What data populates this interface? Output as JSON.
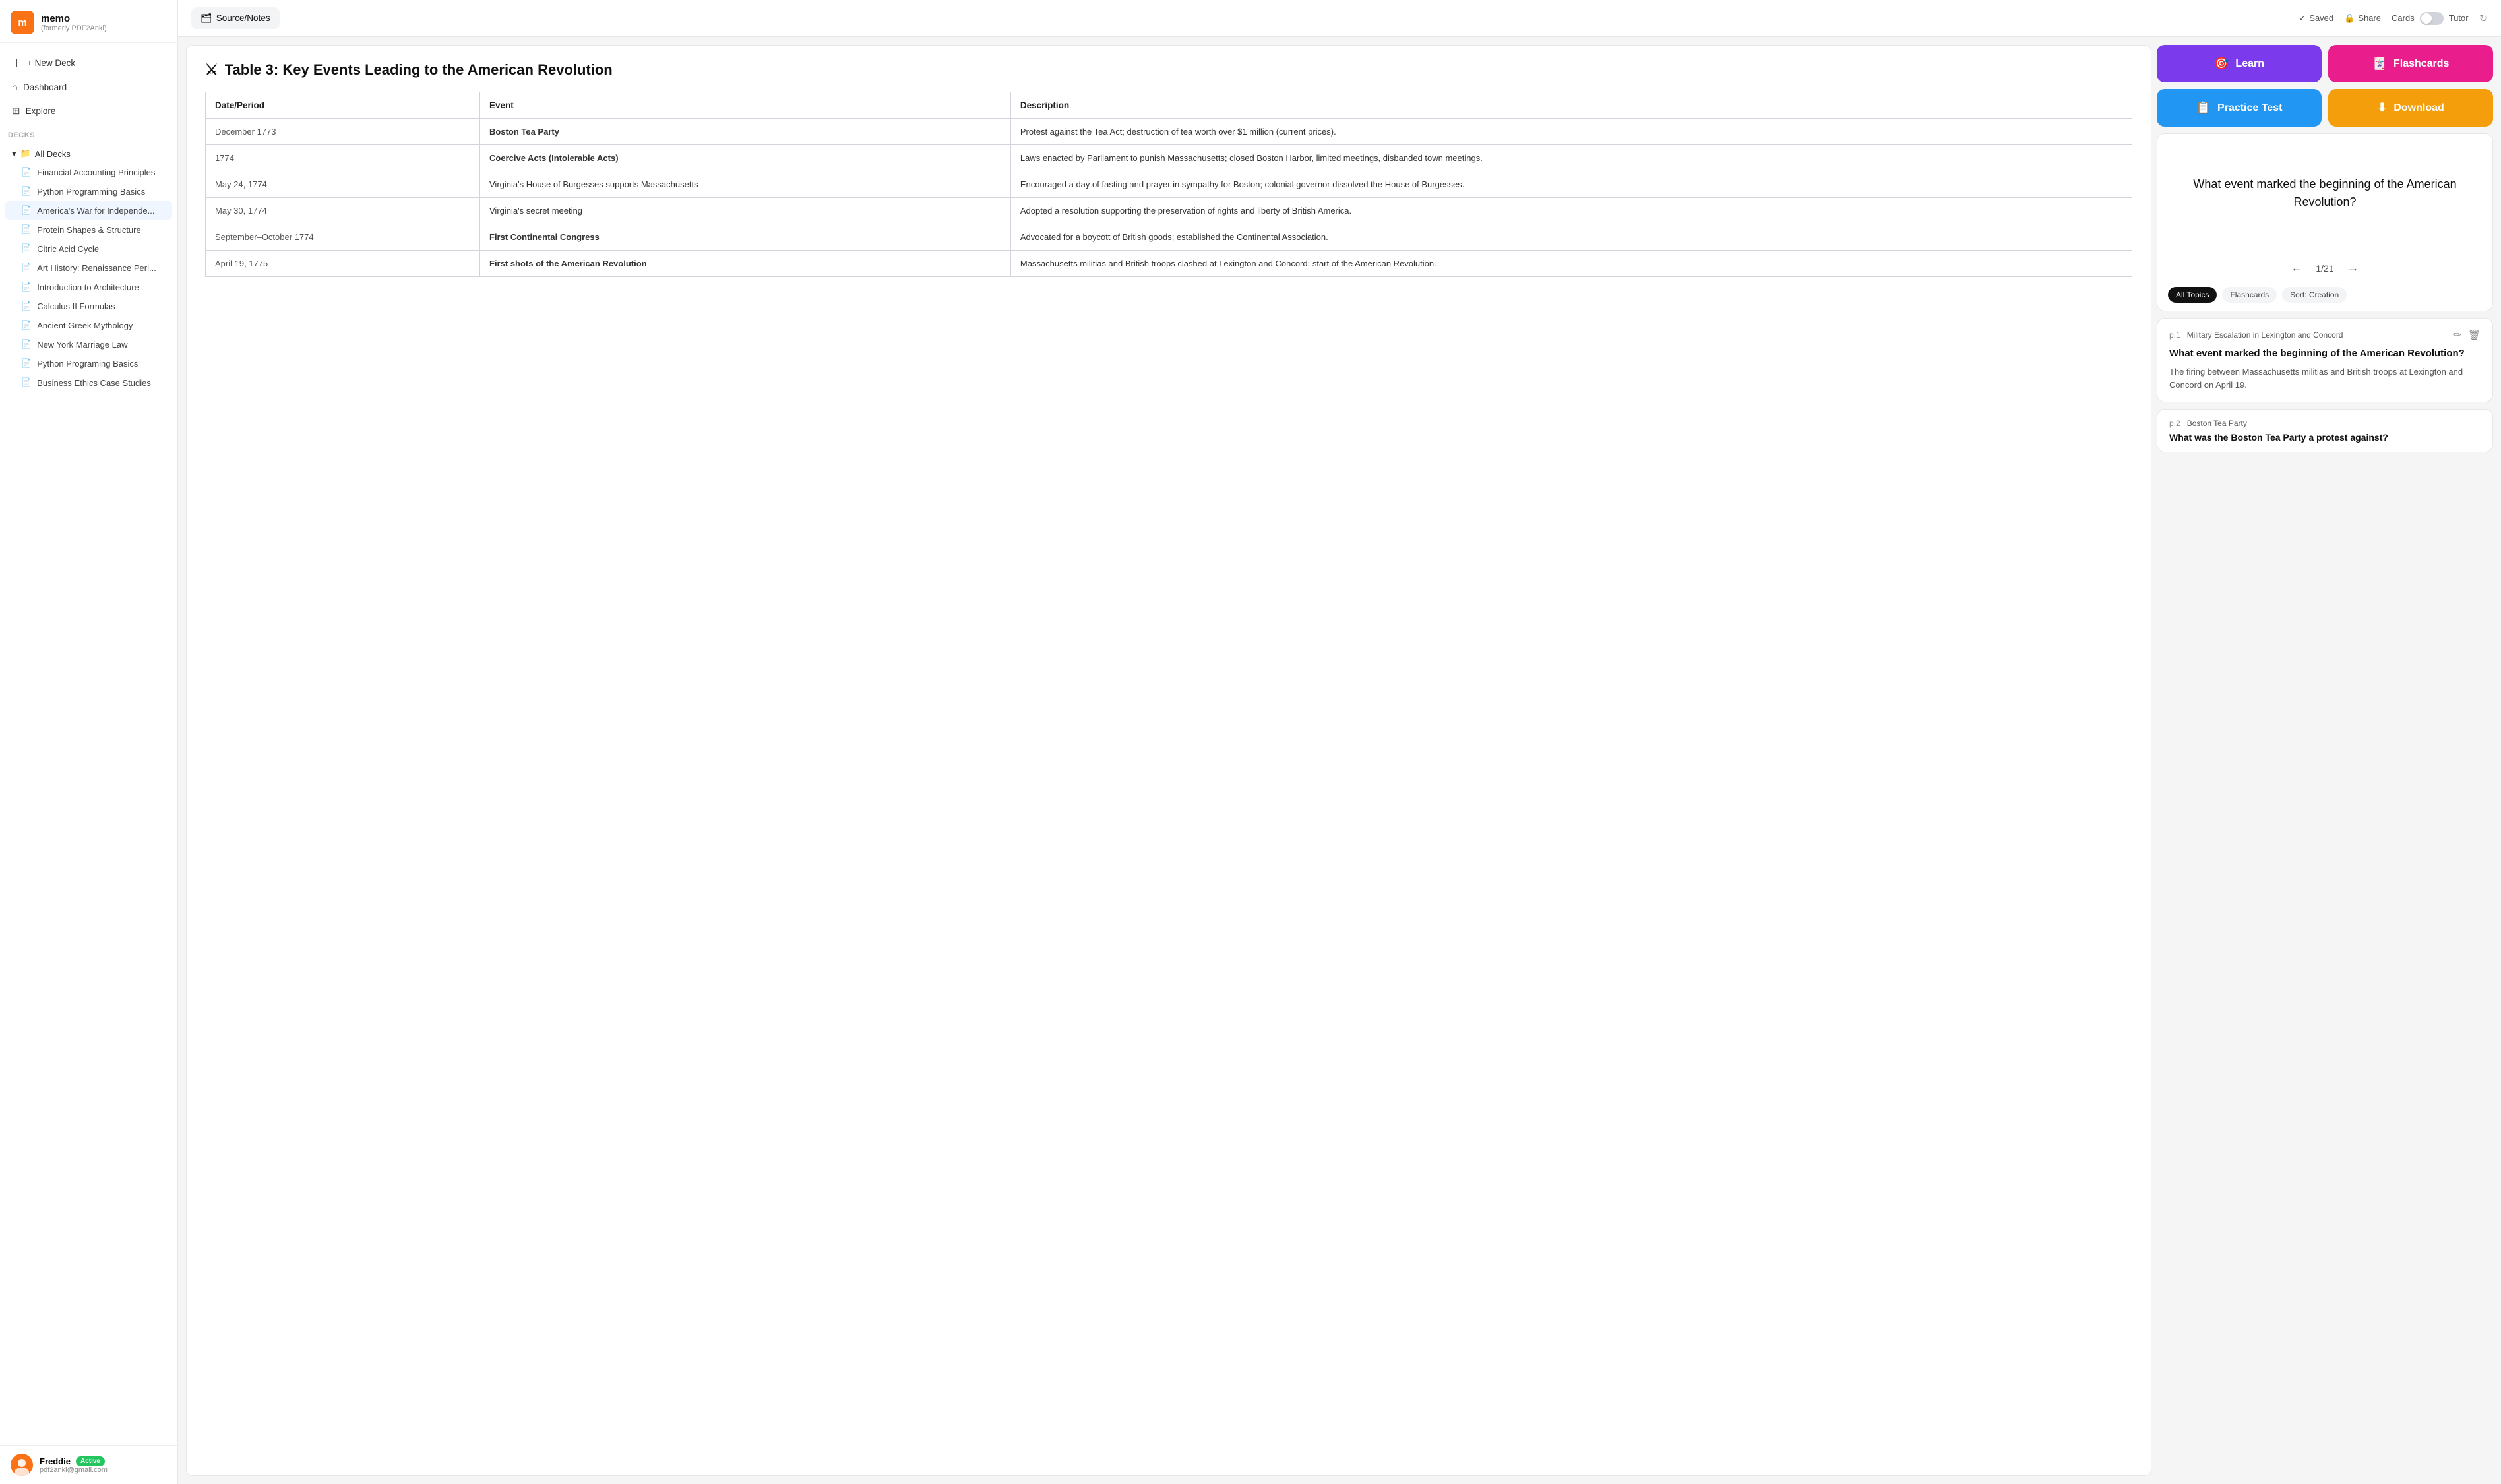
{
  "app": {
    "name": "memo",
    "subtitle": "(formerly PDF2Anki)",
    "logo_letter": "m"
  },
  "header": {
    "tab_source": "Source/Notes",
    "saved_text": "Saved",
    "share_text": "Share",
    "cards_text": "Cards",
    "tutor_text": "Tutor",
    "tab_icon": "🗂"
  },
  "sidebar": {
    "new_deck": "+ New Deck",
    "dashboard": "Dashboard",
    "explore": "Explore",
    "decks_label": "Decks",
    "all_decks": "All Decks",
    "deck_items": [
      "Financial Accounting Principles",
      "Python Programming Basics",
      "America's War for Independe...",
      "Protein Shapes & Structure",
      "Citric Acid Cycle",
      "Art History: Renaissance Peri...",
      "Introduction to Architecture",
      "Calculus II Formulas",
      "Ancient Greek Mythology",
      "New York Marriage Law",
      "Python Programing Basics",
      "Business Ethics Case Studies"
    ],
    "active_badge": "Active",
    "user_name": "Freddie",
    "user_email": "pdf2anki@gmail.com"
  },
  "main_content": {
    "table_icon": "⚔",
    "table_title": "Table 3: Key Events Leading to the American Revolution",
    "columns": [
      "Date/Period",
      "Event",
      "Description"
    ],
    "rows": [
      {
        "date": "December 1773",
        "event": "Boston Tea Party",
        "event_bold": true,
        "description": "Protest against the Tea Act; destruction of tea worth over $1 million (current prices)."
      },
      {
        "date": "1774",
        "event": "Coercive Acts (Intolerable Acts)",
        "event_bold": true,
        "description": "Laws enacted by Parliament to punish Massachusetts; closed Boston Harbor, limited meetings, disbanded town meetings."
      },
      {
        "date": "May 24, 1774",
        "event": "Virginia's House of Burgesses supports Massachusetts",
        "event_bold": false,
        "description": "Encouraged a day of fasting and prayer in sympathy for Boston; colonial governor dissolved the House of Burgesses."
      },
      {
        "date": "May 30, 1774",
        "event": "Virginia's secret meeting",
        "event_bold": false,
        "description": "Adopted a resolution supporting the preservation of rights and liberty of British America."
      },
      {
        "date": "September–October 1774",
        "event": "First Continental Congress",
        "event_bold": true,
        "description": "Advocated for a boycott of British goods; established the Continental Association."
      },
      {
        "date": "April 19, 1775",
        "event": "First shots of the American Revolution",
        "event_bold": true,
        "description": "Massachusetts militias and British troops clashed at Lexington and Concord; start of the American Revolution."
      }
    ]
  },
  "right_panel": {
    "btn_learn": "Learn",
    "btn_flashcards": "Flashcards",
    "btn_practice": "Practice Test",
    "btn_download": "Download",
    "flashcard_question": "What event marked the beginning of the American Revolution?",
    "nav_counter": "1/21",
    "filter_all": "All Topics",
    "filter_flashcards": "Flashcards",
    "filter_sort": "Sort: Creation",
    "card1": {
      "page": "p.1",
      "topic": "Military Escalation in Lexington and Concord",
      "question": "What event marked the beginning of the American Revolution?",
      "answer": "The firing between Massachusetts militias and British troops at Lexington and Concord on April 19."
    },
    "card2": {
      "page": "p.2",
      "topic": "Boston Tea Party",
      "question": "What was the Boston Tea Party a protest against?"
    }
  }
}
